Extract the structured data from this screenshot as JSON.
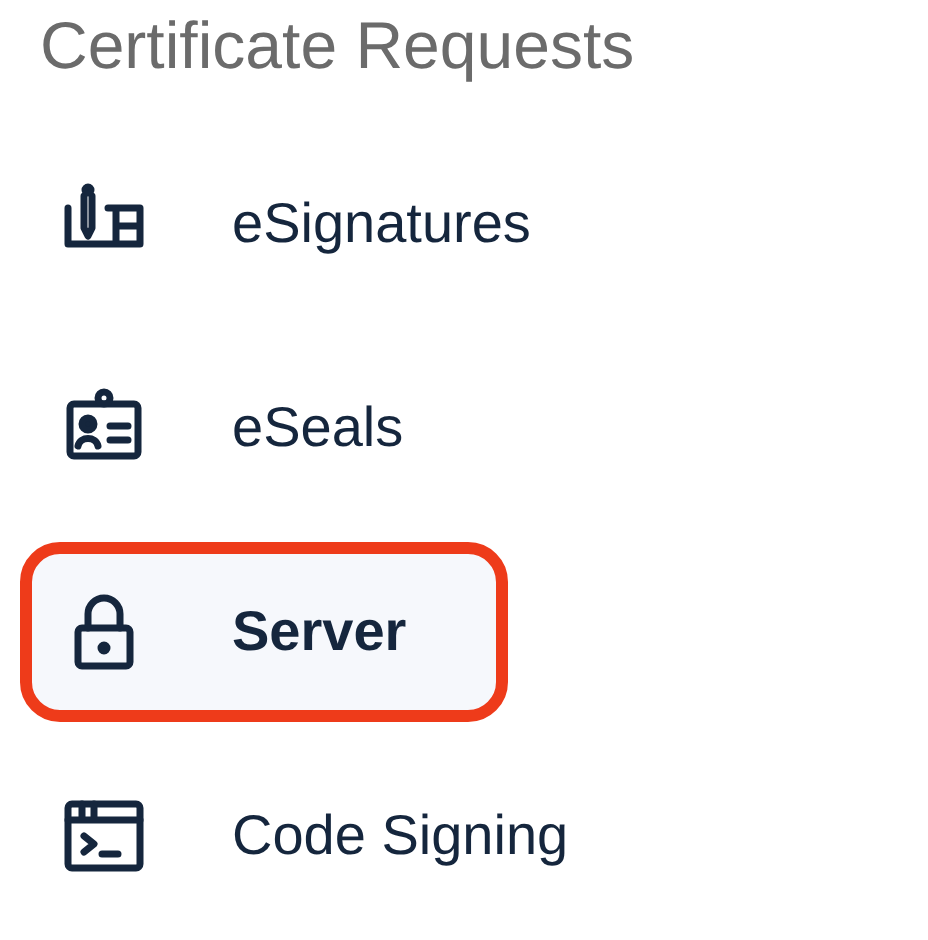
{
  "title": "Certificate Requests",
  "items": [
    {
      "label": "eSignatures",
      "kind": "signature",
      "selected": false,
      "highlighted": false
    },
    {
      "label": "eSeals",
      "kind": "badge",
      "selected": false,
      "highlighted": false
    },
    {
      "label": "Server",
      "kind": "lock",
      "selected": true,
      "highlighted": true
    },
    {
      "label": "Code Signing",
      "kind": "terminal",
      "selected": false,
      "highlighted": false
    }
  ]
}
